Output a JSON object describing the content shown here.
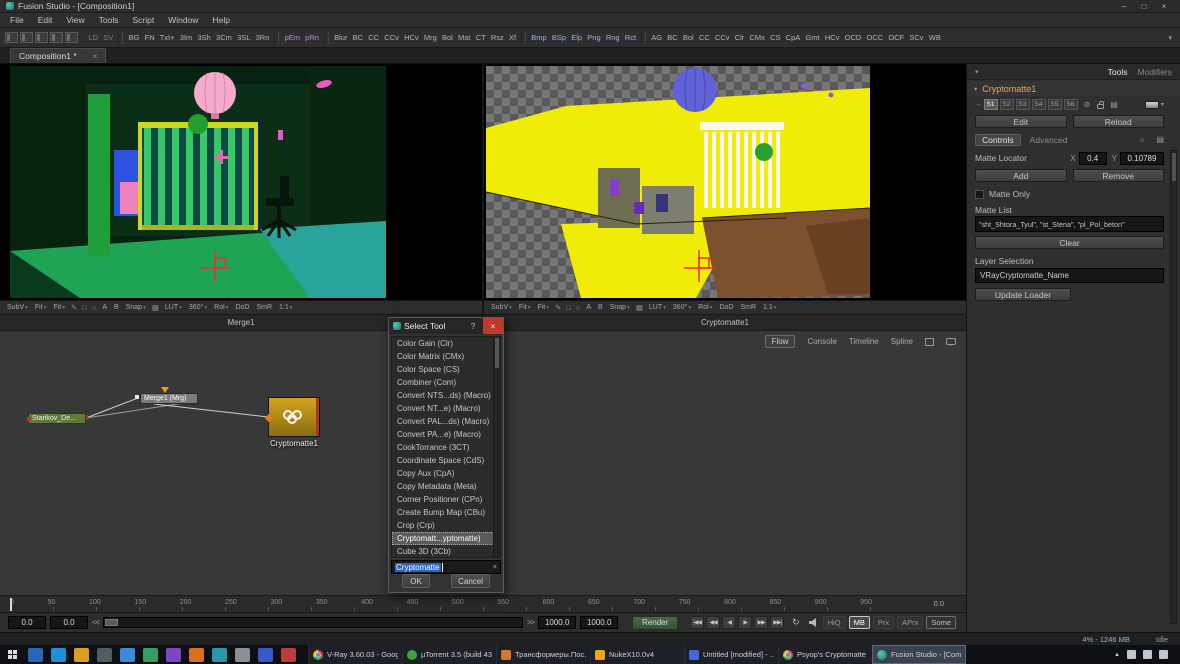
{
  "colors": {
    "accent_orange": "#e87d0d",
    "selection_blue": "#2f62c8",
    "close_red": "#c0392b",
    "crypto_node_yellow": "#d2a41e",
    "render_green": "#37503a"
  },
  "icons": {
    "minimize": "–",
    "maximize": "□",
    "close": "×",
    "help": "?",
    "caret_down": "▾",
    "arrow_right": "→",
    "disable": "⊘",
    "gear": "☼",
    "list": "▤",
    "loop": "↻",
    "chevron_up": "▲"
  },
  "titlebar": {
    "title": "Fusion Studio - [Composition1]"
  },
  "menubar": {
    "items": [
      "File",
      "Edit",
      "View",
      "Tools",
      "Script",
      "Window",
      "Help"
    ]
  },
  "toolbar": {
    "items": [
      {
        "label": "LD",
        "cls": "dim"
      },
      {
        "label": "SV",
        "cls": "dim"
      },
      {
        "label": "",
        "cls": "sep"
      },
      {
        "label": "BG"
      },
      {
        "label": "FN"
      },
      {
        "label": "Txt+"
      },
      {
        "label": "3Im"
      },
      {
        "label": "3Sh"
      },
      {
        "label": "3Cm"
      },
      {
        "label": "3SL"
      },
      {
        "label": "3Rn"
      },
      {
        "label": "",
        "cls": "sep"
      },
      {
        "label": "pEm",
        "cls": "purple"
      },
      {
        "label": "pRn",
        "cls": "purple"
      },
      {
        "label": "",
        "cls": "sep"
      },
      {
        "label": "Blur"
      },
      {
        "label": "BC"
      },
      {
        "label": "CC"
      },
      {
        "label": "CCv"
      },
      {
        "label": "HCv"
      },
      {
        "label": "Mrg"
      },
      {
        "label": "Bol"
      },
      {
        "label": "Mat"
      },
      {
        "label": "CT"
      },
      {
        "label": "Rsz"
      },
      {
        "label": "Xf"
      },
      {
        "label": "",
        "cls": "sep"
      },
      {
        "label": "Bmp",
        "cls": "blue"
      },
      {
        "label": "BSp",
        "cls": "blue"
      },
      {
        "label": "Elp",
        "cls": "blue"
      },
      {
        "label": "Png",
        "cls": "blue"
      },
      {
        "label": "Rng",
        "cls": "blue"
      },
      {
        "label": "Rct",
        "cls": "blue"
      },
      {
        "label": "",
        "cls": "sep"
      },
      {
        "label": "AG"
      },
      {
        "label": "BC"
      },
      {
        "label": "Bol"
      },
      {
        "label": "CC"
      },
      {
        "label": "CCv"
      },
      {
        "label": "Clr"
      },
      {
        "label": "CMx"
      },
      {
        "label": "CS"
      },
      {
        "label": "CpA"
      },
      {
        "label": "Gmt"
      },
      {
        "label": "HCv"
      },
      {
        "label": "OCD"
      },
      {
        "label": "OCC"
      },
      {
        "label": "OCF"
      },
      {
        "label": "SCv"
      },
      {
        "label": "WB"
      }
    ]
  },
  "tabbar": {
    "tab": "Composition1 *"
  },
  "viewerbar": {
    "items": [
      {
        "label": "SubV",
        "cls": "dd"
      },
      {
        "label": "Fit",
        "cls": "dd"
      },
      {
        "label": "Fit",
        "cls": "dd"
      },
      {
        "label": "✎",
        "cls": "ico"
      },
      {
        "label": "□",
        "cls": "ico"
      },
      {
        "label": "○",
        "cls": "ico"
      },
      {
        "label": "A"
      },
      {
        "label": "B"
      },
      {
        "label": "Snap",
        "cls": "dd"
      },
      {
        "label": "▦",
        "cls": "ico"
      },
      {
        "label": "LUT",
        "cls": "dd"
      },
      {
        "label": "360°",
        "cls": "dd"
      },
      {
        "label": "Rol",
        "cls": "dd"
      },
      {
        "label": "DoD"
      },
      {
        "label": "SmR"
      },
      {
        "label": "1:1",
        "cls": "dd"
      }
    ]
  },
  "viewers": {
    "left_label": "Merge1",
    "right_label": "Cryptomatte1"
  },
  "flowtabs": {
    "items": [
      {
        "label": "Flow",
        "cls": "active"
      },
      {
        "label": "Console"
      },
      {
        "label": "Timeline"
      },
      {
        "label": "Spline"
      }
    ]
  },
  "nodes": {
    "loader": "Starikov_De...",
    "merge": "Merge1 (Mrg)",
    "crypto": "Cryptomatte1"
  },
  "dialog": {
    "title": "Select Tool",
    "items": [
      {
        "label": "Color Gain (Clr)"
      },
      {
        "label": "Color Matrix (CMx)"
      },
      {
        "label": "Color Space (CS)"
      },
      {
        "label": "Combiner (Com)"
      },
      {
        "label": "Convert NTS...ds) (Macro)"
      },
      {
        "label": "Convert NT...e) (Macro)"
      },
      {
        "label": "Convert PAL...ds) (Macro)"
      },
      {
        "label": "Convert PA...e) (Macro)"
      },
      {
        "label": "CookTorrance (3CT)"
      },
      {
        "label": "Coordinate Space (CdS)"
      },
      {
        "label": "Copy Aux (CpA)"
      },
      {
        "label": "Copy Metadata (Meta)"
      },
      {
        "label": "Corner Positioner (CPn)"
      },
      {
        "label": "Create Bump Map (CBu)"
      },
      {
        "label": "Crop (Crp)"
      },
      {
        "label": "Cryptomatt...yptomatte)",
        "cls": "selected"
      },
      {
        "label": "Cube 3D (3Cb)"
      }
    ],
    "search_value": "Cryptomatte",
    "ok": "OK",
    "cancel": "Cancel"
  },
  "inspector": {
    "tab_tools": "Tools",
    "tab_modifiers": "Modifiers",
    "node_name": "Cryptomatte1",
    "versions": [
      {
        "label": "S1",
        "cls": "active"
      },
      {
        "label": "S2"
      },
      {
        "label": "S3"
      },
      {
        "label": "S4"
      },
      {
        "label": "S5"
      },
      {
        "label": "S6"
      }
    ],
    "edit": "Edit",
    "reload": "Reload",
    "tab_controls": "Controls",
    "tab_advanced": "Advanced",
    "matte_locator_label": "Matte Locator",
    "x_label": "X",
    "x_value": "0.4",
    "y_label": "Y",
    "y_value": "0.10789",
    "add": "Add",
    "remove": "Remove",
    "matte_only": "Matte Only",
    "matte_list_label": "Matte List",
    "matte_list_value": "\"sht_Shtora_Tyul\", \"st_Stena\", \"pl_Pol_beton\"",
    "clear": "Clear",
    "layer_selection_label": "Layer Selection",
    "layer_selection_value": "VRayCryptomatte_Name",
    "update_loader": "Update Loader"
  },
  "ruler": {
    "ticks": [
      "0",
      "50",
      "100",
      "150",
      "200",
      "250",
      "300",
      "350",
      "400",
      "450",
      "500",
      "550",
      "600",
      "650",
      "700",
      "750",
      "800",
      "850",
      "900",
      "950"
    ],
    "end_value": "0.0"
  },
  "transport": {
    "global_start": "0.0",
    "render_start": "0.0",
    "rw": "<<",
    "ff": ">>",
    "render_end": "1000.0",
    "global_end": "1000.0",
    "render": "Render",
    "buttons": [
      "|◀◀",
      "◀◀",
      "◀",
      "▶",
      "▶▶",
      "▶▶|"
    ],
    "quality": [
      {
        "label": "HiQ",
        "cls": "dim"
      },
      {
        "label": "MB",
        "cls": "active"
      },
      {
        "label": "Prx",
        "cls": "dim"
      },
      {
        "label": "APrx",
        "cls": "dim"
      },
      {
        "label": "Some",
        "cls": "on"
      }
    ]
  },
  "status": {
    "memory": "4% - 1246 MB",
    "state": "Idle"
  },
  "taskbar": {
    "apps": [
      {
        "label": "V-Ray 3.60.03 - Googl...",
        "cls": "ic-chrome"
      },
      {
        "label": "µTorrent 3.5 (build 43...",
        "cls": "ic-utorrent"
      },
      {
        "label": "Трансформеры.Пос...",
        "cls": "ic-media"
      },
      {
        "label": "NukeX10.0v4",
        "cls": "ic-nuke"
      },
      {
        "label": "Untitled [modified] - ...",
        "cls": "ic-notepad"
      },
      {
        "label": "Psyop's Cryptomatte ...",
        "cls": "ic-chrome"
      },
      {
        "label": "Fusion Studio - [Com...",
        "cls": "ic-fusion active"
      }
    ]
  }
}
